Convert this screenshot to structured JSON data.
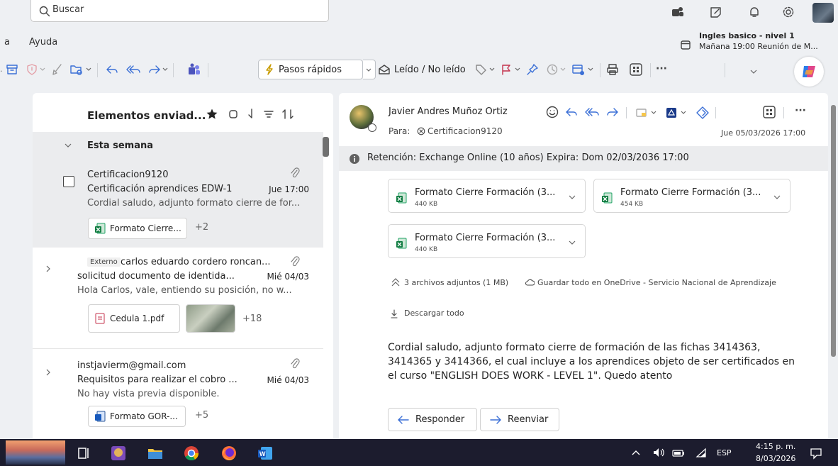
{
  "search": {
    "placeholder": "Buscar"
  },
  "menu": {
    "partial": "a",
    "help": "Ayuda"
  },
  "reminder": {
    "title": "Ingles basico - nivel 1",
    "detail": "Mañana 19:00 Reunión de M..."
  },
  "toolbar": {
    "quick_steps": "Pasos rápidos",
    "read_unread": "Leído / No leído",
    "more": "···"
  },
  "folder": {
    "title": "Elementos enviad...",
    "group": "Esta semana"
  },
  "emails": [
    {
      "from": "Certificacion9120",
      "subject": "Certificación aprendices EDW-1",
      "date": "Jue 17:00",
      "preview": "Cordial saludo, adjunto formato cierre de for...",
      "chip": "Formato Cierre...",
      "more": "+2"
    },
    {
      "tag": "Externo",
      "from": "carlos eduardo cordero roncan...",
      "subject": "solicitud documento de identida...",
      "date": "Mié 04/03",
      "preview": "Hola Carlos, vale, entiendo su posición, no w...",
      "chip": "Cedula 1.pdf",
      "more": "+18"
    },
    {
      "from": "instjavierm@gmail.com",
      "subject": "Requisitos para realizar el cobro ...",
      "date": "Mié 04/03",
      "preview": "No hay vista previa disponible.",
      "chip": "Formato GOR-...",
      "more": "+5"
    }
  ],
  "message": {
    "sender": "Javier Andres Muñoz Ortiz",
    "to_label": "Para:",
    "to": "Certificacion9120",
    "date": "Jue 05/03/2026 17:00",
    "retention": "Retención: Exchange Online (10 años) Expira: Dom 02/03/2036 17:00",
    "attachments": [
      {
        "name": "Formato Cierre Formación (3...",
        "size": "440 KB"
      },
      {
        "name": "Formato Cierre Formación (3...",
        "size": "454 KB"
      },
      {
        "name": "Formato Cierre Formación (3...",
        "size": "440 KB"
      }
    ],
    "attach_summary": "3 archivos adjuntos (1 MB)",
    "save_onedrive": "Guardar todo en OneDrive - Servicio Nacional de Aprendizaje",
    "download_all": "Descargar todo",
    "body": "Cordial saludo, adjunto formato cierre de formación de las fichas 3414363, 3414365 y 3414366, el cual incluye a los aprendices objeto de ser certificados en el curso \"ENGLISH DOES WORK - LEVEL 1\". Quedo atento",
    "reply": "Responder",
    "forward": "Reenviar"
  },
  "taskbar": {
    "lang": "ESP",
    "time": "4:15 p. m.",
    "date": "8/03/2026"
  }
}
